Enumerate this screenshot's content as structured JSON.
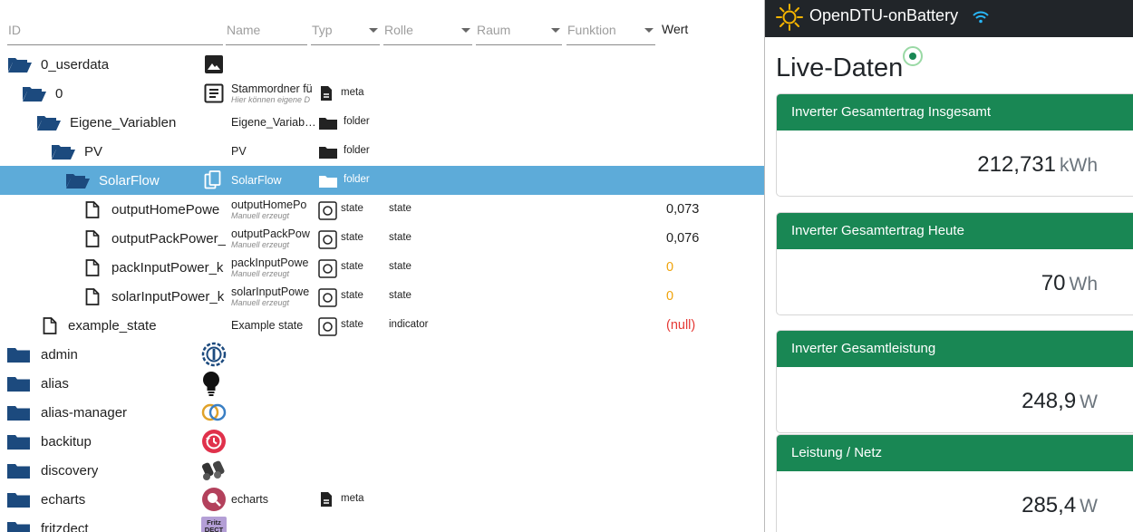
{
  "tree": {
    "columns": {
      "id": "ID",
      "name": "Name",
      "type": "Typ",
      "role": "Rolle",
      "room": "Raum",
      "function": "Funktion",
      "value": "Wert"
    },
    "rows": [
      {
        "label": "0_userdata",
        "icon": "image-icon"
      },
      {
        "label": "0",
        "name": "Stammordner fü",
        "sub": "Hier können eigene D",
        "type": "meta"
      },
      {
        "label": "Eigene_Variablen",
        "name": "Eigene_Variab…",
        "type": "folder"
      },
      {
        "label": "PV",
        "name": "PV",
        "type": "folder"
      },
      {
        "label": "SolarFlow",
        "name": "SolarFlow",
        "type": "folder"
      },
      {
        "label": "outputHomePowe",
        "name": "outputHomePo",
        "sub": "Manuell erzeugt",
        "type": "state",
        "role": "state",
        "value": "0,073"
      },
      {
        "label": "outputPackPower_",
        "name": "outputPackPow",
        "sub": "Manuell erzeugt",
        "type": "state",
        "role": "state",
        "value": "0,076"
      },
      {
        "label": "packInputPower_k",
        "name": "packInputPowe",
        "sub": "Manuell erzeugt",
        "type": "state",
        "role": "state",
        "value": "0"
      },
      {
        "label": "solarInputPower_k",
        "name": "solarInputPowe",
        "sub": "Manuell erzeugt",
        "type": "state",
        "role": "state",
        "value": "0"
      },
      {
        "label": "example_state",
        "name": "Example state",
        "type": "state",
        "role": "indicator",
        "value": "(null)"
      },
      {
        "label": "admin",
        "icon": "admin-adapter-icon"
      },
      {
        "label": "alias",
        "icon": "lightbulb-icon"
      },
      {
        "label": "alias-manager",
        "icon": "alias-manager-icon"
      },
      {
        "label": "backitup",
        "icon": "backup-restore-icon"
      },
      {
        "label": "discovery",
        "icon": "binoculars-icon"
      },
      {
        "label": "echarts",
        "icon": "echarts-icon",
        "name": "echarts",
        "type": "meta"
      },
      {
        "label": "fritzdect",
        "icon": "fritz-dect-icon",
        "icon_text": "Fritz DECT"
      }
    ],
    "colors": {
      "selected_row": "#5dabd9",
      "folder": "#1c4a7e",
      "value_zero": "#f0a30a",
      "value_null": "#e53935"
    }
  },
  "dtu": {
    "brand": "OpenDTU-onBattery",
    "page_title": "Live-Daten",
    "accent": "#198754",
    "cards": [
      {
        "title": "Inverter Gesamtertrag Insgesamt",
        "value": "212,731",
        "unit": "kWh"
      },
      {
        "title": "Inverter Gesamtertrag Heute",
        "value": "70",
        "unit": "Wh"
      },
      {
        "title": "Inverter Gesamtleistung",
        "value": "248,9",
        "unit": "W"
      },
      {
        "title": "Leistung / Netz",
        "value": "285,4",
        "unit": "W"
      }
    ]
  }
}
